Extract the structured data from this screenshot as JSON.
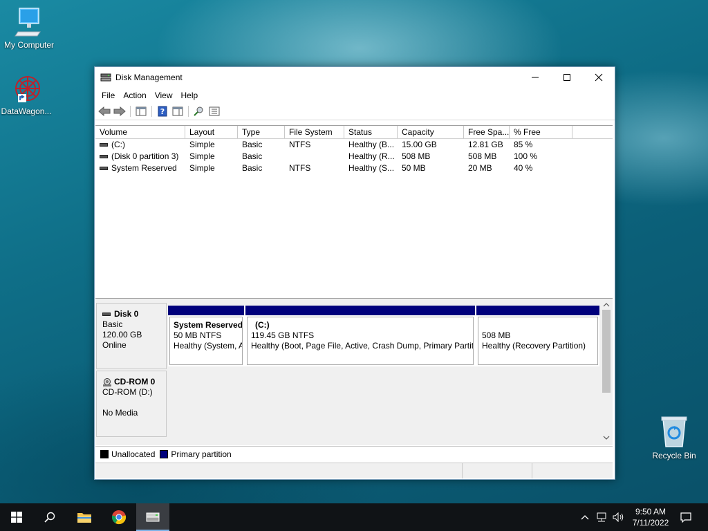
{
  "desktop": {
    "icons": [
      {
        "label": "My Computer",
        "icon": "computer-icon"
      },
      {
        "label": "DataWagon...",
        "icon": "datawagon-shortcut-icon"
      },
      {
        "label": "Recycle Bin",
        "icon": "recycle-bin-icon"
      }
    ]
  },
  "window": {
    "title": "Disk Management",
    "menu": [
      "File",
      "Action",
      "View",
      "Help"
    ],
    "toolbar_icons": [
      "back-icon",
      "forward-icon",
      "show-hide-console-tree-icon",
      "help-icon",
      "show-hide-action-pane-icon",
      "connect-icon",
      "properties-icon"
    ]
  },
  "volume_list": {
    "columns": [
      "Volume",
      "Layout",
      "Type",
      "File System",
      "Status",
      "Capacity",
      "Free Spa...",
      "% Free"
    ],
    "rows": [
      [
        "(C:)",
        "Simple",
        "Basic",
        "NTFS",
        "Healthy (B...",
        "15.00 GB",
        "12.81 GB",
        "85 %"
      ],
      [
        "(Disk 0 partition 3)",
        "Simple",
        "Basic",
        "",
        "Healthy (R...",
        "508 MB",
        "508 MB",
        "100 %"
      ],
      [
        "System Reserved",
        "Simple",
        "Basic",
        "NTFS",
        "Healthy (S...",
        "50 MB",
        "20 MB",
        "40 %"
      ]
    ]
  },
  "disks": [
    {
      "name": "Disk 0",
      "type": "Basic",
      "size": "120.00 GB",
      "state": "Online",
      "partitions": [
        {
          "title": "System Reserved",
          "line2": "50 MB NTFS",
          "line3": "Healthy (System, A"
        },
        {
          "title": "(C:)",
          "line2": "119.45 GB NTFS",
          "line3": "Healthy (Boot, Page File, Active, Crash Dump, Primary Partiti"
        },
        {
          "title": "",
          "line2": "508 MB",
          "line3": "Healthy (Recovery Partition)"
        }
      ]
    },
    {
      "name": "CD-ROM 0",
      "type": "CD-ROM (D:)",
      "size": "",
      "state": "No Media"
    }
  ],
  "legend": [
    {
      "label": "Unallocated",
      "color": "#000000"
    },
    {
      "label": "Primary partition",
      "color": "#00007c"
    }
  ],
  "taskbar": {
    "time": "9:50 AM",
    "date": "7/11/2022"
  }
}
